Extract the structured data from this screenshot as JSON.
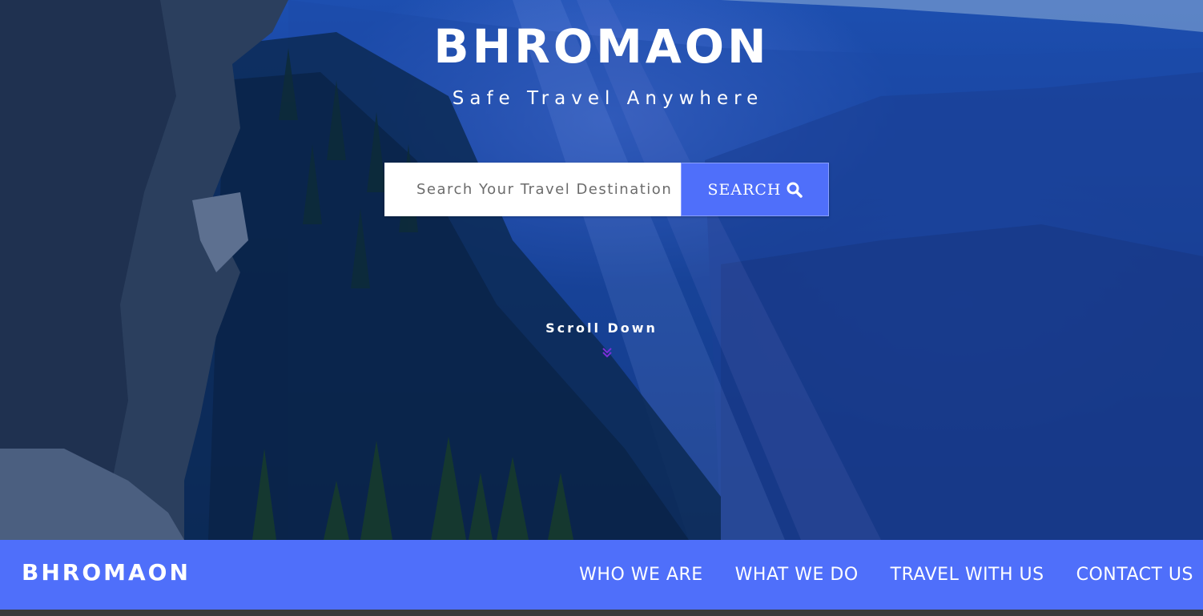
{
  "hero": {
    "title": "BHROMAON",
    "tagline": "Safe Travel Anywhere",
    "search": {
      "placeholder": "Search Your Travel Destination",
      "button_label": "SEARCH"
    },
    "scroll_label": "Scroll Down"
  },
  "navbar": {
    "logo": "BHROMAON",
    "links": [
      "WHO WE ARE",
      "WHAT WE DO",
      "TRAVEL WITH US",
      "CONTACT US"
    ]
  },
  "colors": {
    "accent": "#4f6ffa",
    "chevron": "#7a2fd8"
  },
  "icons": {
    "search": "search-icon",
    "scroll": "chevron-down-icon"
  }
}
